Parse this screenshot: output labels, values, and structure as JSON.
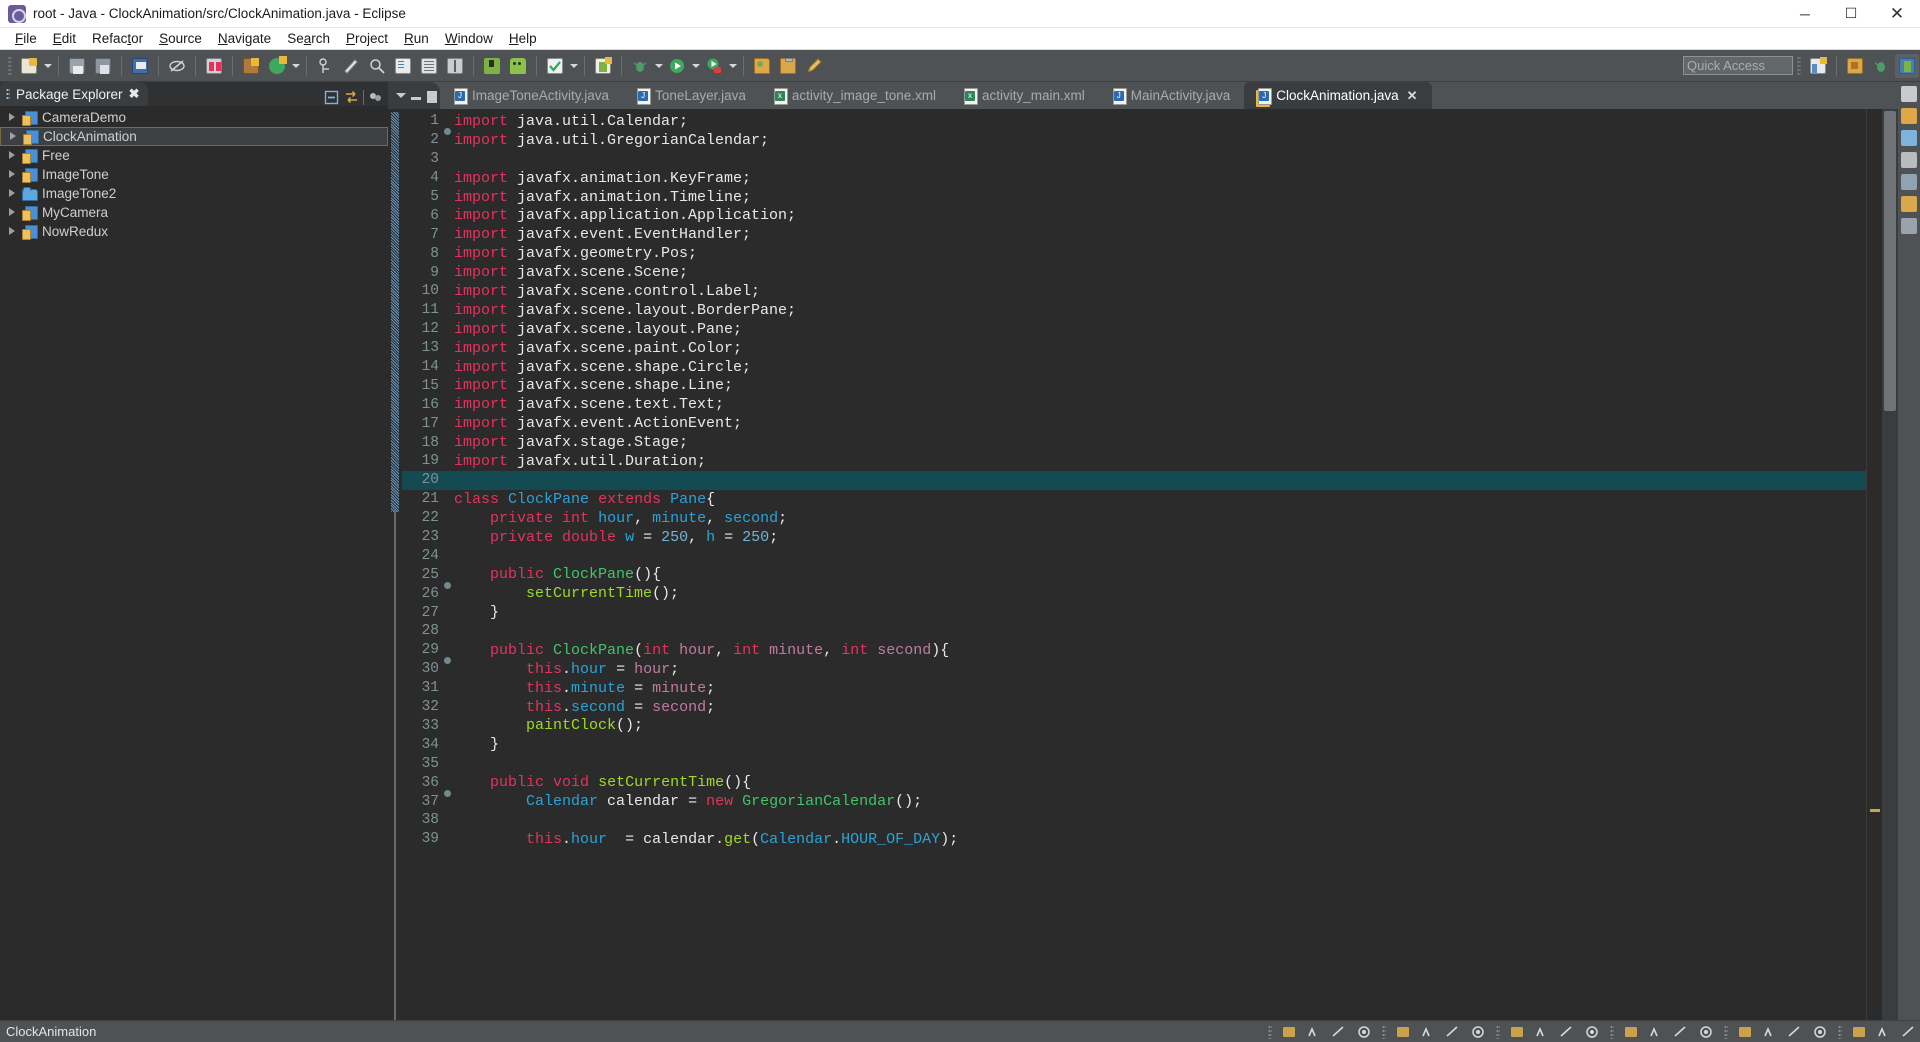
{
  "window": {
    "title": "root - Java - ClockAnimation/src/ClockAnimation.java - Eclipse",
    "app_icon": "eclipse-icon",
    "minimize": "─",
    "maximize": "☐",
    "close": "✕"
  },
  "menu": {
    "items": [
      {
        "label": "File",
        "mnemonic": "F"
      },
      {
        "label": "Edit",
        "mnemonic": "E"
      },
      {
        "label": "Refactor",
        "mnemonic": "t"
      },
      {
        "label": "Source",
        "mnemonic": "S"
      },
      {
        "label": "Navigate",
        "mnemonic": "N"
      },
      {
        "label": "Search",
        "mnemonic": "a"
      },
      {
        "label": "Project",
        "mnemonic": "P"
      },
      {
        "label": "Run",
        "mnemonic": "R"
      },
      {
        "label": "Window",
        "mnemonic": "W"
      },
      {
        "label": "Help",
        "mnemonic": "H"
      }
    ]
  },
  "toolbar": {
    "quick_access_placeholder": "Quick Access",
    "buttons": [
      "new-wizard-icon",
      "save-icon",
      "save-all-icon",
      "print-icon",
      "toggle-mark-occurrences-icon",
      "new-java-package-icon",
      "new-java-class-icon",
      "new-annotation-icon",
      "open-type-icon",
      "search-icon",
      "debug-icon",
      "external-tools-icon",
      "build-all-icon",
      "android-sdk-manager-icon",
      "android-avd-manager-icon",
      "check-icon",
      "run-last-tool-icon",
      "debug-run-icon",
      "run-icon",
      "run-configurations-icon",
      "open-perspective-icon",
      "clipboard-icon",
      "pencil-icon"
    ],
    "right_buttons": [
      "new-perspective-icon",
      "java-perspective-icon",
      "debug-perspective-icon",
      "ddms-perspective-icon"
    ]
  },
  "package_explorer": {
    "title": "Package Explorer",
    "close_label": "✖",
    "tools": [
      "collapse-all-icon",
      "link-with-editor-icon",
      "view-menu-icon"
    ],
    "items": [
      {
        "label": "CameraDemo",
        "icon": "java-project-icon",
        "selected": false
      },
      {
        "label": "ClockAnimation",
        "icon": "java-project-icon",
        "selected": true
      },
      {
        "label": "Free",
        "icon": "java-project-icon",
        "selected": false
      },
      {
        "label": "ImageTone",
        "icon": "java-project-icon",
        "selected": false
      },
      {
        "label": "ImageTone2",
        "icon": "folder-icon",
        "selected": false
      },
      {
        "label": "MyCamera",
        "icon": "java-project-icon",
        "selected": false
      },
      {
        "label": "NowRedux",
        "icon": "java-project-icon",
        "selected": false
      }
    ]
  },
  "editor": {
    "tabs": [
      {
        "label": "ImageToneActivity.java",
        "icon": "java-file-icon",
        "active": false,
        "closable": false
      },
      {
        "label": "ToneLayer.java",
        "icon": "java-file-icon",
        "active": false,
        "closable": false
      },
      {
        "label": "activity_image_tone.xml",
        "icon": "xml-file-icon",
        "active": false,
        "closable": false
      },
      {
        "label": "activity_main.xml",
        "icon": "xml-file-icon",
        "active": false,
        "closable": false
      },
      {
        "label": "MainActivity.java",
        "icon": "java-file-icon",
        "active": false,
        "closable": false
      },
      {
        "label": "ClockAnimation.java",
        "icon": "java-file-warning-icon",
        "active": true,
        "closable": true,
        "close_label": "✕"
      }
    ],
    "view_buttons": [
      "tab-list-icon",
      "minimize-icon",
      "maximize-icon"
    ],
    "current_line": 20,
    "code_lines": [
      {
        "n": 1,
        "fold": true,
        "tokens": [
          {
            "t": "import",
            "c": "kw"
          },
          {
            "t": " java.util.Calendar;",
            "c": "plain"
          }
        ]
      },
      {
        "n": 2,
        "fold": false,
        "tokens": [
          {
            "t": "import",
            "c": "kw"
          },
          {
            "t": " java.util.GregorianCalendar;",
            "c": "plain"
          }
        ]
      },
      {
        "n": 3,
        "fold": false,
        "tokens": []
      },
      {
        "n": 4,
        "fold": false,
        "tokens": [
          {
            "t": "import",
            "c": "kw"
          },
          {
            "t": " javafx.animation.KeyFrame;",
            "c": "plain"
          }
        ]
      },
      {
        "n": 5,
        "fold": false,
        "tokens": [
          {
            "t": "import",
            "c": "kw"
          },
          {
            "t": " javafx.animation.Timeline;",
            "c": "plain"
          }
        ]
      },
      {
        "n": 6,
        "fold": false,
        "tokens": [
          {
            "t": "import",
            "c": "kw"
          },
          {
            "t": " javafx.application.Application;",
            "c": "plain"
          }
        ]
      },
      {
        "n": 7,
        "fold": false,
        "tokens": [
          {
            "t": "import",
            "c": "kw"
          },
          {
            "t": " javafx.event.EventHandler;",
            "c": "plain"
          }
        ]
      },
      {
        "n": 8,
        "fold": false,
        "tokens": [
          {
            "t": "import",
            "c": "kw"
          },
          {
            "t": " javafx.geometry.Pos;",
            "c": "plain"
          }
        ]
      },
      {
        "n": 9,
        "fold": false,
        "tokens": [
          {
            "t": "import",
            "c": "kw"
          },
          {
            "t": " javafx.scene.Scene;",
            "c": "plain"
          }
        ]
      },
      {
        "n": 10,
        "fold": false,
        "tokens": [
          {
            "t": "import",
            "c": "kw"
          },
          {
            "t": " javafx.scene.control.Label;",
            "c": "plain"
          }
        ]
      },
      {
        "n": 11,
        "fold": false,
        "tokens": [
          {
            "t": "import",
            "c": "kw"
          },
          {
            "t": " javafx.scene.layout.BorderPane;",
            "c": "plain"
          }
        ]
      },
      {
        "n": 12,
        "fold": false,
        "tokens": [
          {
            "t": "import",
            "c": "kw"
          },
          {
            "t": " javafx.scene.layout.Pane;",
            "c": "plain"
          }
        ]
      },
      {
        "n": 13,
        "fold": false,
        "tokens": [
          {
            "t": "import",
            "c": "kw"
          },
          {
            "t": " javafx.scene.paint.Color;",
            "c": "plain"
          }
        ]
      },
      {
        "n": 14,
        "fold": false,
        "tokens": [
          {
            "t": "import",
            "c": "kw"
          },
          {
            "t": " javafx.scene.shape.Circle;",
            "c": "plain"
          }
        ]
      },
      {
        "n": 15,
        "fold": false,
        "tokens": [
          {
            "t": "import",
            "c": "kw"
          },
          {
            "t": " javafx.scene.shape.Line;",
            "c": "plain"
          }
        ]
      },
      {
        "n": 16,
        "fold": false,
        "tokens": [
          {
            "t": "import",
            "c": "kw"
          },
          {
            "t": " javafx.scene.text.Text;",
            "c": "plain"
          }
        ]
      },
      {
        "n": 17,
        "fold": false,
        "tokens": [
          {
            "t": "import",
            "c": "kw"
          },
          {
            "t": " javafx.event.ActionEvent;",
            "c": "plain"
          }
        ]
      },
      {
        "n": 18,
        "fold": false,
        "tokens": [
          {
            "t": "import",
            "c": "kw"
          },
          {
            "t": " javafx.stage.Stage;",
            "c": "plain"
          }
        ]
      },
      {
        "n": 19,
        "fold": false,
        "tokens": [
          {
            "t": "import",
            "c": "kw"
          },
          {
            "t": " javafx.util.Duration;",
            "c": "plain"
          }
        ]
      },
      {
        "n": 20,
        "fold": false,
        "current": true,
        "tokens": []
      },
      {
        "n": 21,
        "fold": false,
        "tokens": [
          {
            "t": "class",
            "c": "kw"
          },
          {
            "t": " ",
            "c": "plain"
          },
          {
            "t": "ClockPane",
            "c": "typ"
          },
          {
            "t": " ",
            "c": "plain"
          },
          {
            "t": "extends",
            "c": "kw"
          },
          {
            "t": " ",
            "c": "plain"
          },
          {
            "t": "Pane",
            "c": "typ"
          },
          {
            "t": "{",
            "c": "plain"
          }
        ]
      },
      {
        "n": 22,
        "fold": false,
        "tokens": [
          {
            "t": "    ",
            "c": "plain"
          },
          {
            "t": "private",
            "c": "kw"
          },
          {
            "t": " ",
            "c": "plain"
          },
          {
            "t": "int",
            "c": "kw"
          },
          {
            "t": " ",
            "c": "plain"
          },
          {
            "t": "hour",
            "c": "fld"
          },
          {
            "t": ", ",
            "c": "plain"
          },
          {
            "t": "minute",
            "c": "fld"
          },
          {
            "t": ", ",
            "c": "plain"
          },
          {
            "t": "second",
            "c": "fld"
          },
          {
            "t": ";",
            "c": "plain"
          }
        ]
      },
      {
        "n": 23,
        "fold": false,
        "tokens": [
          {
            "t": "    ",
            "c": "plain"
          },
          {
            "t": "private",
            "c": "kw"
          },
          {
            "t": " ",
            "c": "plain"
          },
          {
            "t": "double",
            "c": "kw"
          },
          {
            "t": " ",
            "c": "plain"
          },
          {
            "t": "w",
            "c": "fld"
          },
          {
            "t": " = ",
            "c": "plain"
          },
          {
            "t": "250",
            "c": "num"
          },
          {
            "t": ", ",
            "c": "plain"
          },
          {
            "t": "h",
            "c": "fld"
          },
          {
            "t": " = ",
            "c": "plain"
          },
          {
            "t": "250",
            "c": "num"
          },
          {
            "t": ";",
            "c": "plain"
          }
        ]
      },
      {
        "n": 24,
        "fold": false,
        "tokens": []
      },
      {
        "n": 25,
        "fold": true,
        "tokens": [
          {
            "t": "    ",
            "c": "plain"
          },
          {
            "t": "public",
            "c": "kw"
          },
          {
            "t": " ",
            "c": "plain"
          },
          {
            "t": "ClockPane",
            "c": "ctor"
          },
          {
            "t": "(){",
            "c": "plain"
          }
        ]
      },
      {
        "n": 26,
        "fold": false,
        "tokens": [
          {
            "t": "        ",
            "c": "plain"
          },
          {
            "t": "setCurrentTime",
            "c": "mth"
          },
          {
            "t": "();",
            "c": "plain"
          }
        ]
      },
      {
        "n": 27,
        "fold": false,
        "tokens": [
          {
            "t": "    }",
            "c": "plain"
          }
        ]
      },
      {
        "n": 28,
        "fold": false,
        "tokens": []
      },
      {
        "n": 29,
        "fold": true,
        "tokens": [
          {
            "t": "    ",
            "c": "plain"
          },
          {
            "t": "public",
            "c": "kw"
          },
          {
            "t": " ",
            "c": "plain"
          },
          {
            "t": "ClockPane",
            "c": "ctor"
          },
          {
            "t": "(",
            "c": "plain"
          },
          {
            "t": "int",
            "c": "kw"
          },
          {
            "t": " ",
            "c": "plain"
          },
          {
            "t": "hour",
            "c": "param"
          },
          {
            "t": ", ",
            "c": "plain"
          },
          {
            "t": "int",
            "c": "kw"
          },
          {
            "t": " ",
            "c": "plain"
          },
          {
            "t": "minute",
            "c": "param"
          },
          {
            "t": ", ",
            "c": "plain"
          },
          {
            "t": "int",
            "c": "kw"
          },
          {
            "t": " ",
            "c": "plain"
          },
          {
            "t": "second",
            "c": "param"
          },
          {
            "t": "){",
            "c": "plain"
          }
        ]
      },
      {
        "n": 30,
        "fold": false,
        "tokens": [
          {
            "t": "        ",
            "c": "plain"
          },
          {
            "t": "this",
            "c": "kw"
          },
          {
            "t": ".",
            "c": "plain"
          },
          {
            "t": "hour",
            "c": "fld"
          },
          {
            "t": " = ",
            "c": "plain"
          },
          {
            "t": "hour",
            "c": "param"
          },
          {
            "t": ";",
            "c": "plain"
          }
        ]
      },
      {
        "n": 31,
        "fold": false,
        "tokens": [
          {
            "t": "        ",
            "c": "plain"
          },
          {
            "t": "this",
            "c": "kw"
          },
          {
            "t": ".",
            "c": "plain"
          },
          {
            "t": "minute",
            "c": "fld"
          },
          {
            "t": " = ",
            "c": "plain"
          },
          {
            "t": "minute",
            "c": "param"
          },
          {
            "t": ";",
            "c": "plain"
          }
        ]
      },
      {
        "n": 32,
        "fold": false,
        "tokens": [
          {
            "t": "        ",
            "c": "plain"
          },
          {
            "t": "this",
            "c": "kw"
          },
          {
            "t": ".",
            "c": "plain"
          },
          {
            "t": "second",
            "c": "fld"
          },
          {
            "t": " = ",
            "c": "plain"
          },
          {
            "t": "second",
            "c": "param"
          },
          {
            "t": ";",
            "c": "plain"
          }
        ]
      },
      {
        "n": 33,
        "fold": false,
        "tokens": [
          {
            "t": "        ",
            "c": "plain"
          },
          {
            "t": "paintClock",
            "c": "mth"
          },
          {
            "t": "();",
            "c": "plain"
          }
        ]
      },
      {
        "n": 34,
        "fold": false,
        "tokens": [
          {
            "t": "    }",
            "c": "plain"
          }
        ]
      },
      {
        "n": 35,
        "fold": false,
        "tokens": []
      },
      {
        "n": 36,
        "fold": true,
        "tokens": [
          {
            "t": "    ",
            "c": "plain"
          },
          {
            "t": "public",
            "c": "kw"
          },
          {
            "t": " ",
            "c": "plain"
          },
          {
            "t": "void",
            "c": "kw"
          },
          {
            "t": " ",
            "c": "plain"
          },
          {
            "t": "setCurrentTime",
            "c": "mth"
          },
          {
            "t": "(){",
            "c": "plain"
          }
        ]
      },
      {
        "n": 37,
        "fold": false,
        "tokens": [
          {
            "t": "        ",
            "c": "plain"
          },
          {
            "t": "Calendar",
            "c": "typ"
          },
          {
            "t": " ",
            "c": "plain"
          },
          {
            "t": "calendar",
            "c": "plain"
          },
          {
            "t": " = ",
            "c": "plain"
          },
          {
            "t": "new",
            "c": "kw"
          },
          {
            "t": " ",
            "c": "plain"
          },
          {
            "t": "GregorianCalendar",
            "c": "ctor"
          },
          {
            "t": "();",
            "c": "plain"
          }
        ]
      },
      {
        "n": 38,
        "fold": false,
        "tokens": []
      },
      {
        "n": 39,
        "fold": false,
        "tokens": [
          {
            "t": "        ",
            "c": "plain"
          },
          {
            "t": "this",
            "c": "kw"
          },
          {
            "t": ".",
            "c": "plain"
          },
          {
            "t": "hour",
            "c": "fld"
          },
          {
            "t": "  = ",
            "c": "plain"
          },
          {
            "t": "calendar",
            "c": "plain"
          },
          {
            "t": ".",
            "c": "plain"
          },
          {
            "t": "get",
            "c": "mth"
          },
          {
            "t": "(",
            "c": "plain"
          },
          {
            "t": "Calendar",
            "c": "typ"
          },
          {
            "t": ".",
            "c": "plain"
          },
          {
            "t": "HOUR_OF_DAY",
            "c": "fld"
          },
          {
            "t": ");",
            "c": "plain"
          }
        ]
      }
    ]
  },
  "status_bar": {
    "text": "ClockAnimation"
  },
  "colors": {
    "keyword": "#e4325f",
    "type": "#2aa3d8",
    "method": "#9fd92a",
    "constructor": "#3fc56b",
    "number": "#6fb5d9",
    "parameter": "#c27ba0",
    "editor_bg": "#2b2b2b",
    "current_line": "#144a52",
    "chrome": "#4e5254",
    "panel_bg": "#3a3d3f"
  }
}
